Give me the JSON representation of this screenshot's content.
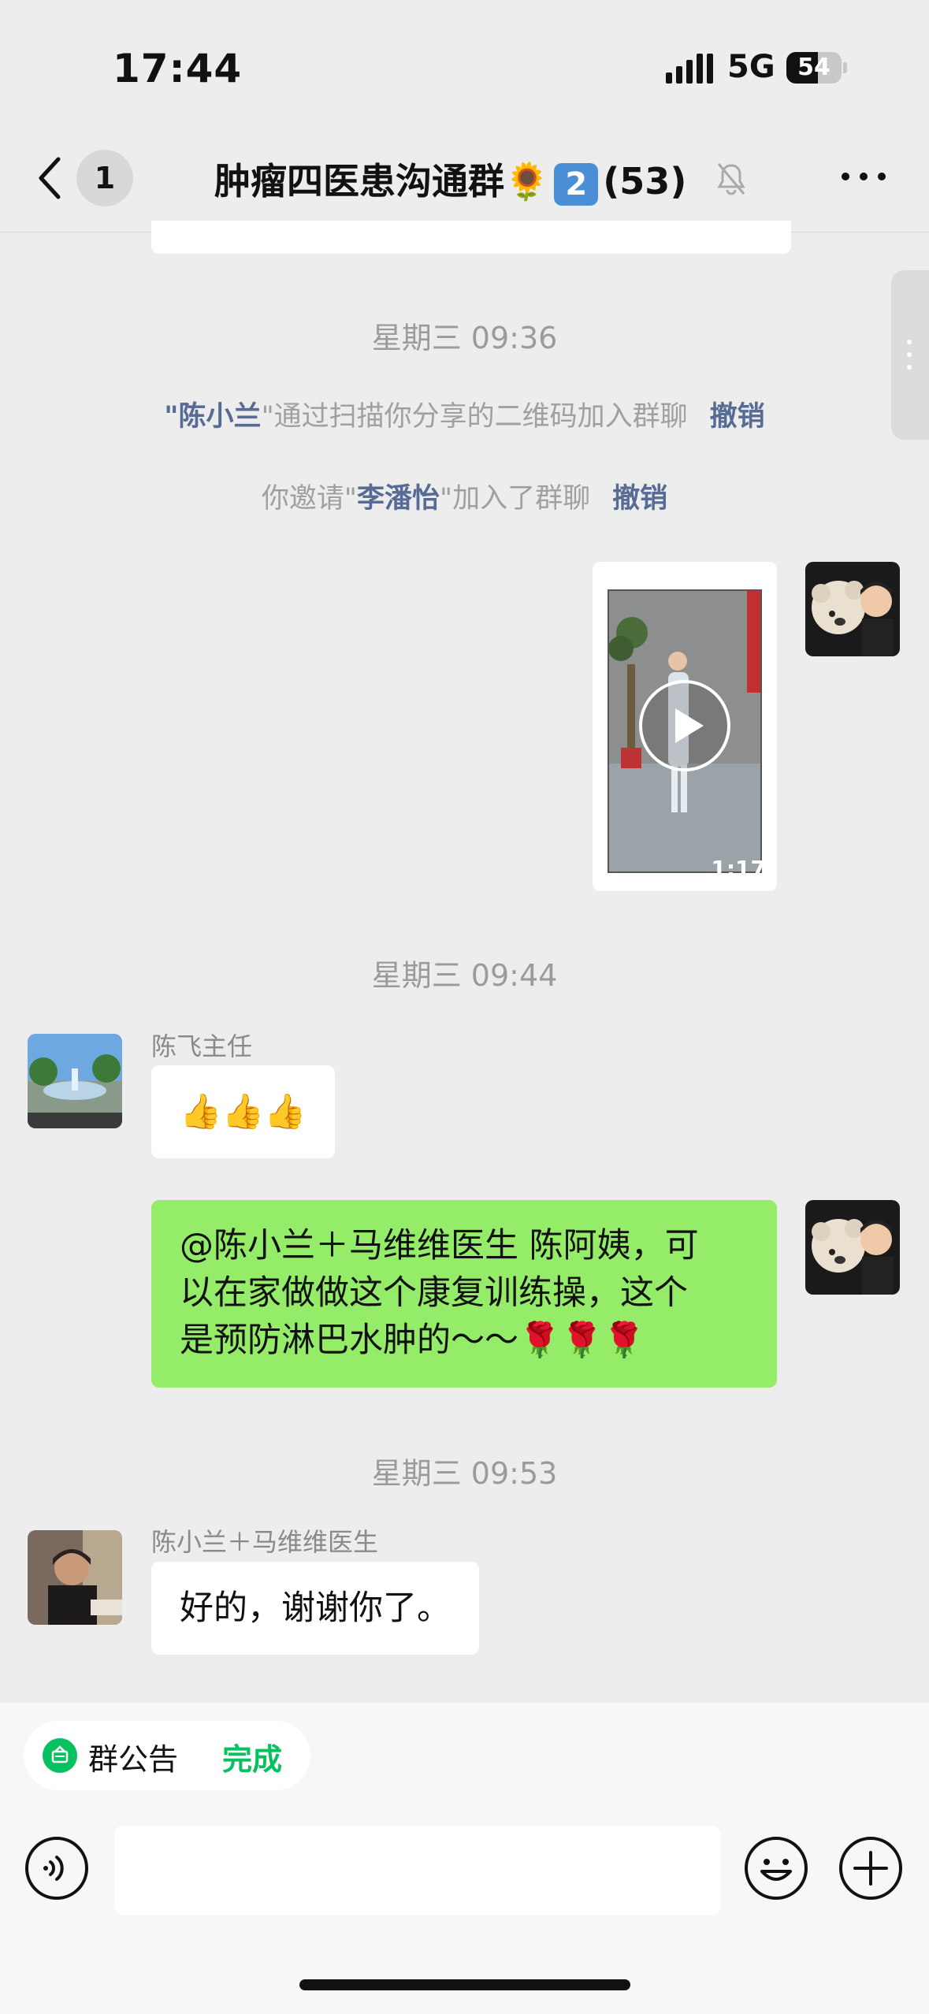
{
  "status_bar": {
    "time": "17:44",
    "network": "5G",
    "battery": "54"
  },
  "nav": {
    "unread_count": "1",
    "title_name": "肿瘤四医患沟通群",
    "title_sunflower": "🌻",
    "title_number_badge": "2",
    "title_member_count": "(53)",
    "icons": {
      "back": "chevron-left-icon",
      "mute": "bell-muted-icon",
      "more": "more-dots-icon"
    }
  },
  "messages": {
    "ts1": "星期三 09:36",
    "sys1": {
      "quote_open": "\"",
      "name": "陈小兰",
      "text": "\"通过扫描你分享的二维码加入群聊",
      "revoke": "撤销"
    },
    "sys2": {
      "prefix": "你邀请\"",
      "name": "李潘怡",
      "suffix": "\"加入了群聊",
      "revoke": "撤销"
    },
    "video": {
      "duration": "1:17"
    },
    "ts2": "星期三 09:44",
    "msg1": {
      "sender": "陈飞主任",
      "text": "👍👍👍"
    },
    "msg2": {
      "lines": [
        "@陈小兰＋马维维医生 陈阿姨，可",
        "以在家做做这个康复训练操，这个",
        "是预防淋巴水肿的～～🌹🌹🌹"
      ]
    },
    "ts3": "星期三 09:53",
    "msg3": {
      "sender": "陈小兰＋马维维医生",
      "text": "好的，谢谢你了。"
    }
  },
  "bottom": {
    "notice_label": "群公告",
    "notice_done": "完成",
    "input_placeholder": "",
    "icons": {
      "voice": "voice-icon",
      "emoji": "emoji-icon",
      "plus": "plus-icon"
    }
  },
  "colors": {
    "link": "#576b95",
    "bubble_self": "#95ec69",
    "accent": "#07c160",
    "background": "#ededed"
  }
}
